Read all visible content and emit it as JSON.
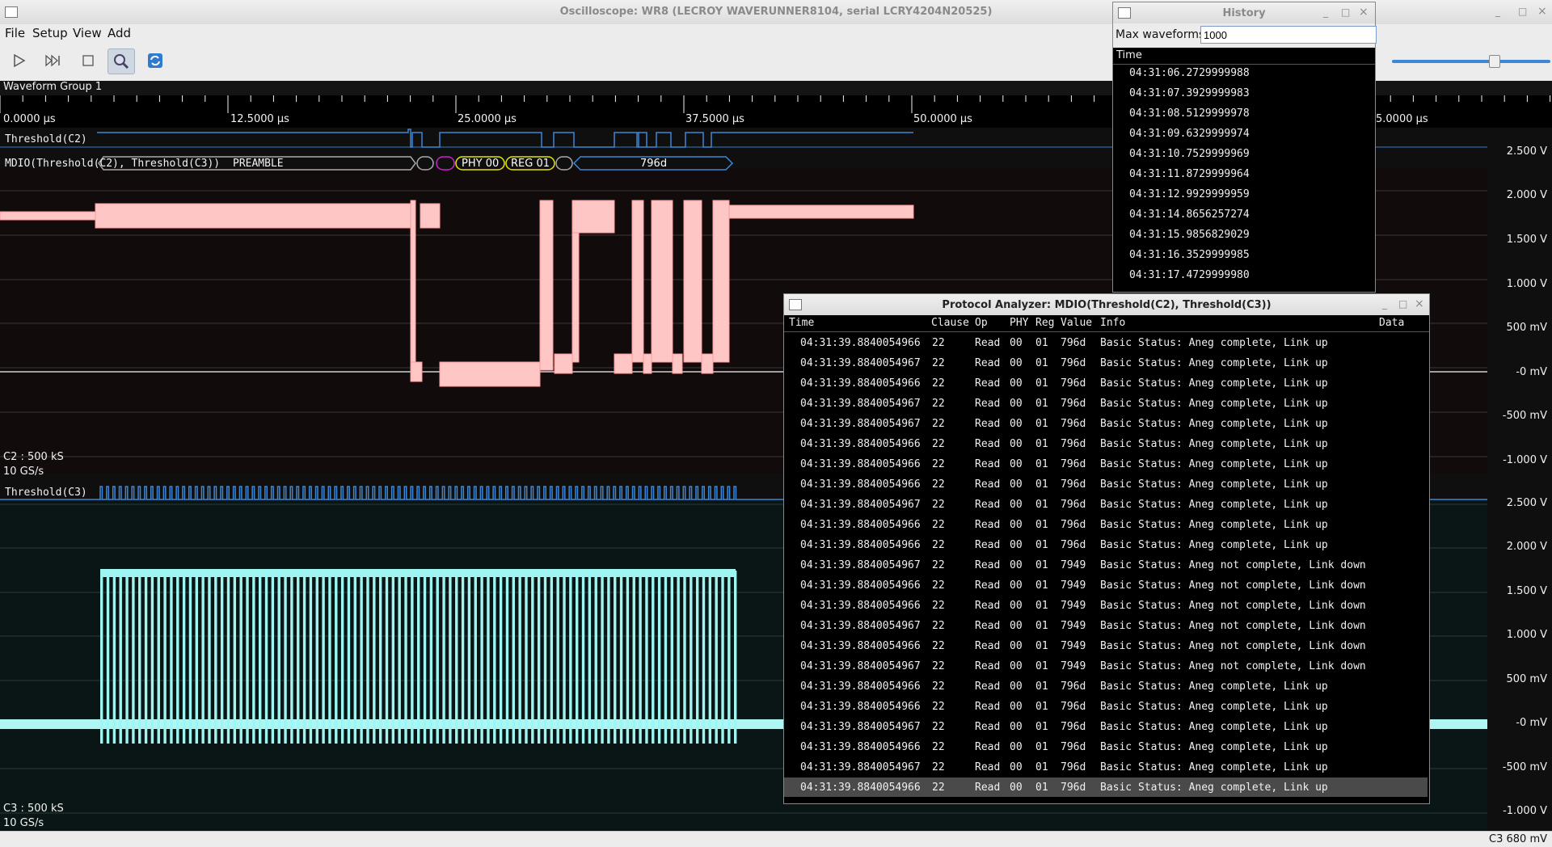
{
  "window": {
    "title": "Oscilloscope: WR8 (LECROY WAVERUNNER8104, serial LCRY4204N20525)",
    "controls": [
      "_",
      "□",
      "×"
    ]
  },
  "menu": [
    "File",
    "Setup",
    "View",
    "Add"
  ],
  "toolbar": {
    "buttons": [
      "play-icon",
      "step-icon",
      "stop-icon",
      "zoom-icon",
      "refresh-icon"
    ]
  },
  "group": {
    "label": "Waveform Group 1"
  },
  "timeline": {
    "labels": [
      "0.0000 µs",
      "12.5000 µs",
      "25.0000 µs",
      "37.5000 µs",
      "50.0000 µs",
      "5.0000 µs"
    ]
  },
  "upper": {
    "threshold_label": "Threshold(C2)",
    "mdio_label": "MDIO(Threshold(C2), Threshold(C3))",
    "packets": [
      "PREAMBLE",
      "",
      "",
      "PHY 00",
      "REG 01",
      "",
      "796d"
    ],
    "channel_label": "C2 : 500 kS",
    "rate_label": "10 GS/s",
    "volts": [
      "2.500 V",
      "2.000 V",
      "1.500 V",
      "1.000 V",
      "500 mV",
      "-0 mV",
      "-500 mV",
      "-1.000 V"
    ]
  },
  "lower": {
    "threshold_label": "Threshold(C3)",
    "channel_label": "C3 : 500 kS",
    "rate_label": "10 GS/s",
    "volts": [
      "2.500 V",
      "2.000 V",
      "1.500 V",
      "1.000 V",
      "500 mV",
      "-0 mV",
      "-500 mV",
      "-1.000 V"
    ]
  },
  "status": {
    "right": "C3 680 mV"
  },
  "history": {
    "title": "History",
    "max_label": "Max waveforms",
    "max_value": "1000",
    "col": "Time",
    "rows": [
      "04:31:06.2729999988",
      "04:31:07.3929999983",
      "04:31:08.5129999978",
      "04:31:09.6329999974",
      "04:31:10.7529999969",
      "04:31:11.8729999964",
      "04:31:12.9929999959",
      "04:31:14.8656257274",
      "04:31:15.9856829029",
      "04:31:16.3529999985",
      "04:31:17.4729999980"
    ]
  },
  "protocol": {
    "title": "Protocol Analyzer: MDIO(Threshold(C2), Threshold(C3))",
    "headers": {
      "time": "Time",
      "clause": "Clause",
      "op": "Op",
      "phy": "PHY",
      "reg": "Reg",
      "value": "Value",
      "info": "Info",
      "data": "Data"
    },
    "rows": [
      {
        "time": "04:31:39.8840054966",
        "clause": "22",
        "op": "Read",
        "phy": "00",
        "reg": "01",
        "value": "796d",
        "info": "Basic Status: Aneg complete, Link up"
      },
      {
        "time": "04:31:39.8840054967",
        "clause": "22",
        "op": "Read",
        "phy": "00",
        "reg": "01",
        "value": "796d",
        "info": "Basic Status: Aneg complete, Link up"
      },
      {
        "time": "04:31:39.8840054966",
        "clause": "22",
        "op": "Read",
        "phy": "00",
        "reg": "01",
        "value": "796d",
        "info": "Basic Status: Aneg complete, Link up"
      },
      {
        "time": "04:31:39.8840054967",
        "clause": "22",
        "op": "Read",
        "phy": "00",
        "reg": "01",
        "value": "796d",
        "info": "Basic Status: Aneg complete, Link up"
      },
      {
        "time": "04:31:39.8840054967",
        "clause": "22",
        "op": "Read",
        "phy": "00",
        "reg": "01",
        "value": "796d",
        "info": "Basic Status: Aneg complete, Link up"
      },
      {
        "time": "04:31:39.8840054966",
        "clause": "22",
        "op": "Read",
        "phy": "00",
        "reg": "01",
        "value": "796d",
        "info": "Basic Status: Aneg complete, Link up"
      },
      {
        "time": "04:31:39.8840054966",
        "clause": "22",
        "op": "Read",
        "phy": "00",
        "reg": "01",
        "value": "796d",
        "info": "Basic Status: Aneg complete, Link up"
      },
      {
        "time": "04:31:39.8840054966",
        "clause": "22",
        "op": "Read",
        "phy": "00",
        "reg": "01",
        "value": "796d",
        "info": "Basic Status: Aneg complete, Link up"
      },
      {
        "time": "04:31:39.8840054967",
        "clause": "22",
        "op": "Read",
        "phy": "00",
        "reg": "01",
        "value": "796d",
        "info": "Basic Status: Aneg complete, Link up"
      },
      {
        "time": "04:31:39.8840054966",
        "clause": "22",
        "op": "Read",
        "phy": "00",
        "reg": "01",
        "value": "796d",
        "info": "Basic Status: Aneg complete, Link up"
      },
      {
        "time": "04:31:39.8840054966",
        "clause": "22",
        "op": "Read",
        "phy": "00",
        "reg": "01",
        "value": "796d",
        "info": "Basic Status: Aneg complete, Link up"
      },
      {
        "time": "04:31:39.8840054967",
        "clause": "22",
        "op": "Read",
        "phy": "00",
        "reg": "01",
        "value": "7949",
        "info": "Basic Status: Aneg not complete, Link down"
      },
      {
        "time": "04:31:39.8840054966",
        "clause": "22",
        "op": "Read",
        "phy": "00",
        "reg": "01",
        "value": "7949",
        "info": "Basic Status: Aneg not complete, Link down"
      },
      {
        "time": "04:31:39.8840054966",
        "clause": "22",
        "op": "Read",
        "phy": "00",
        "reg": "01",
        "value": "7949",
        "info": "Basic Status: Aneg not complete, Link down"
      },
      {
        "time": "04:31:39.8840054967",
        "clause": "22",
        "op": "Read",
        "phy": "00",
        "reg": "01",
        "value": "7949",
        "info": "Basic Status: Aneg not complete, Link down"
      },
      {
        "time": "04:31:39.8840054966",
        "clause": "22",
        "op": "Read",
        "phy": "00",
        "reg": "01",
        "value": "7949",
        "info": "Basic Status: Aneg not complete, Link down"
      },
      {
        "time": "04:31:39.8840054967",
        "clause": "22",
        "op": "Read",
        "phy": "00",
        "reg": "01",
        "value": "7949",
        "info": "Basic Status: Aneg not complete, Link down"
      },
      {
        "time": "04:31:39.8840054966",
        "clause": "22",
        "op": "Read",
        "phy": "00",
        "reg": "01",
        "value": "796d",
        "info": "Basic Status: Aneg complete, Link up"
      },
      {
        "time": "04:31:39.8840054966",
        "clause": "22",
        "op": "Read",
        "phy": "00",
        "reg": "01",
        "value": "796d",
        "info": "Basic Status: Aneg complete, Link up"
      },
      {
        "time": "04:31:39.8840054967",
        "clause": "22",
        "op": "Read",
        "phy": "00",
        "reg": "01",
        "value": "796d",
        "info": "Basic Status: Aneg complete, Link up"
      },
      {
        "time": "04:31:39.8840054966",
        "clause": "22",
        "op": "Read",
        "phy": "00",
        "reg": "01",
        "value": "796d",
        "info": "Basic Status: Aneg complete, Link up"
      },
      {
        "time": "04:31:39.8840054967",
        "clause": "22",
        "op": "Read",
        "phy": "00",
        "reg": "01",
        "value": "796d",
        "info": "Basic Status: Aneg complete, Link up"
      },
      {
        "time": "04:31:39.8840054966",
        "clause": "22",
        "op": "Read",
        "phy": "00",
        "reg": "01",
        "value": "796d",
        "info": "Basic Status: Aneg complete, Link up"
      }
    ],
    "selected_index": 22
  },
  "colors": {
    "c2_trace": "#ffb6b6",
    "c3_trace": "#8ff0ee",
    "digital": "#3d87d6",
    "phy_outline": "#e6e600",
    "magenta": "#cc22cc"
  }
}
